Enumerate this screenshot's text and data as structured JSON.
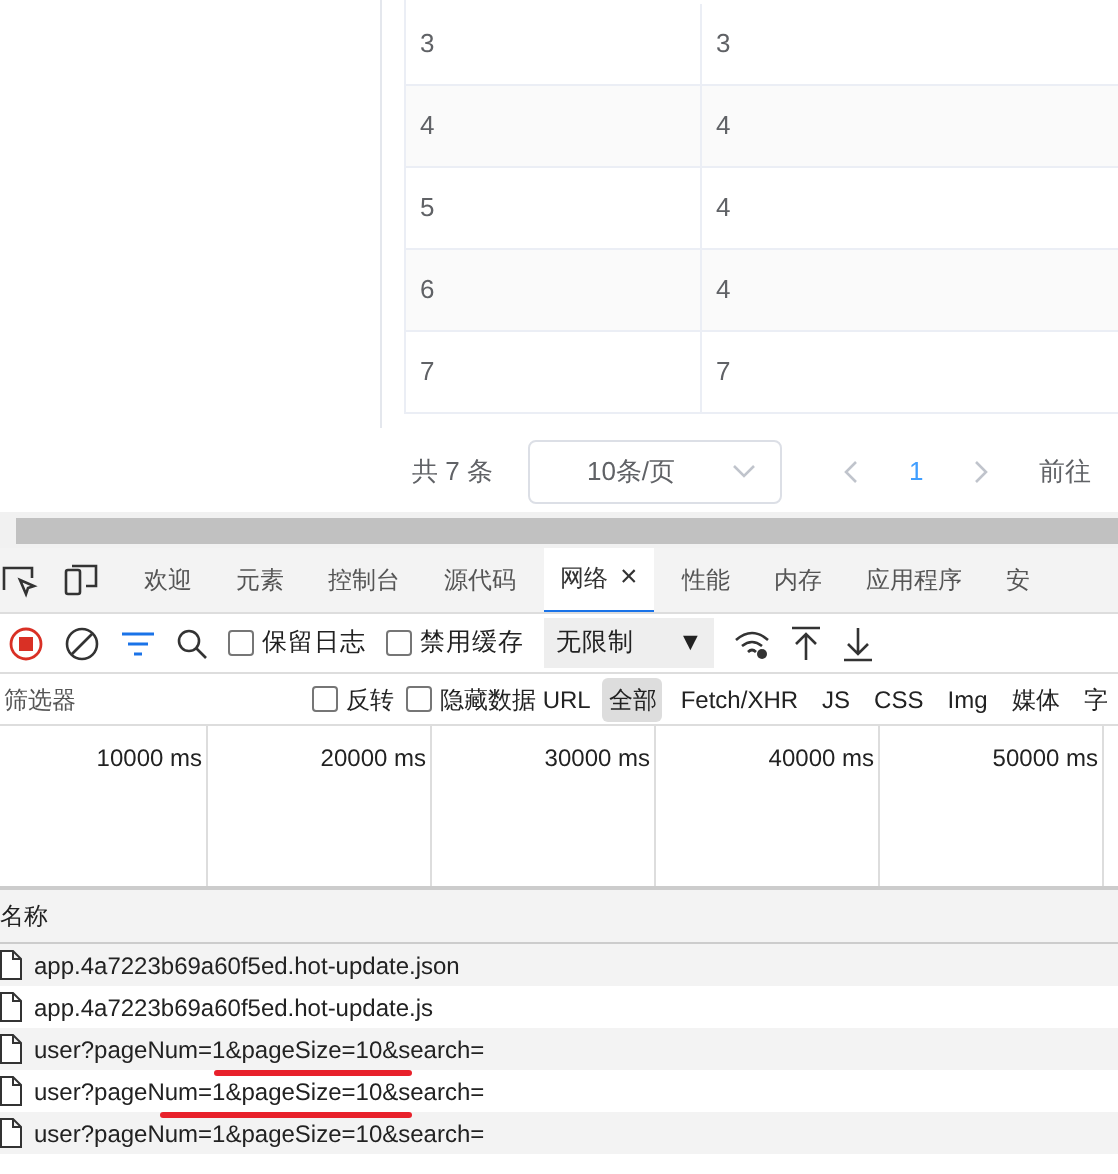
{
  "table": {
    "rows": [
      [
        "3",
        "3"
      ],
      [
        "4",
        "4"
      ],
      [
        "5",
        "4"
      ],
      [
        "6",
        "4"
      ],
      [
        "7",
        "7"
      ]
    ]
  },
  "pagination": {
    "total": "共 7 条",
    "page_size": "10条/页",
    "pages": [
      {
        "label": "1",
        "selected": true
      }
    ],
    "jump_label": "前往"
  },
  "devtools": {
    "tabs": [
      {
        "label": "欢迎",
        "selected": false
      },
      {
        "label": "元素",
        "selected": false
      },
      {
        "label": "控制台",
        "selected": false
      },
      {
        "label": "源代码",
        "selected": false
      },
      {
        "label": "网络",
        "selected": true,
        "close": "×"
      },
      {
        "label": "性能",
        "selected": false
      },
      {
        "label": "内存",
        "selected": false
      },
      {
        "label": "应用程序",
        "selected": false
      },
      {
        "label": "安",
        "selected": false
      }
    ],
    "toolbar": {
      "recording": true,
      "checkboxes": [
        {
          "label": "保留日志",
          "checked": false
        },
        {
          "label": "禁用缓存",
          "checked": false
        }
      ],
      "throttle": "无限制",
      "caret": "▼"
    },
    "filter": {
      "placeholder": "筛选器",
      "checkboxes": [
        {
          "label": "反转",
          "checked": false
        },
        {
          "label": "隐藏数据 URL",
          "checked": false
        }
      ],
      "types": [
        {
          "label": "全部",
          "selected": true
        },
        {
          "label": "Fetch/XHR",
          "selected": false
        },
        {
          "label": "JS",
          "selected": false
        },
        {
          "label": "CSS",
          "selected": false
        },
        {
          "label": "Img",
          "selected": false
        },
        {
          "label": "媒体",
          "selected": false
        },
        {
          "label": "字",
          "selected": false
        }
      ]
    },
    "overview": {
      "ticks": [
        "10000 ms",
        "20000 ms",
        "30000 ms",
        "40000 ms",
        "50000 ms"
      ]
    },
    "requests": {
      "column": "名称",
      "rows": [
        {
          "name": "app.4a7223b69a60f5ed.hot-update.json",
          "marked": false
        },
        {
          "name": "app.4a7223b69a60f5ed.hot-update.js",
          "marked": false
        },
        {
          "name": "user?pageNum=1&pageSize=10&search=",
          "marked": true
        },
        {
          "name": "user?pageNum=1&pageSize=10&search=",
          "marked": true
        },
        {
          "name": "user?pageNum=1&pageSize=10&search=",
          "marked": false
        }
      ]
    }
  }
}
